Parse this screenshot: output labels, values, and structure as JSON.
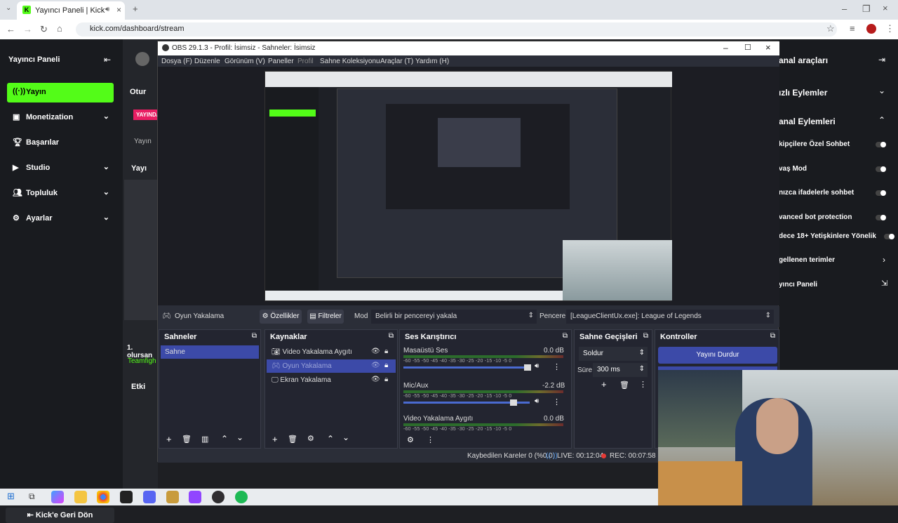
{
  "browser": {
    "tab_title": "Yayıncı Paneli | Kick",
    "url": "kick.com/dashboard/stream"
  },
  "kick": {
    "sidebar_title": "Yayıncı Paneli",
    "items": [
      {
        "label": "Yayın",
        "icon": "broadcast-icon",
        "active": true,
        "chevron": false
      },
      {
        "label": "Monetization",
        "icon": "money-icon",
        "active": false,
        "chevron": true
      },
      {
        "label": "Başarılar",
        "icon": "trophy-icon",
        "active": false,
        "chevron": false
      },
      {
        "label": "Studio",
        "icon": "studio-icon",
        "active": false,
        "chevron": true
      },
      {
        "label": "Topluluk",
        "icon": "community-icon",
        "active": false,
        "chevron": true
      },
      {
        "label": "Ayarlar",
        "icon": "gear-icon",
        "active": false,
        "chevron": true
      }
    ],
    "back_button": "Kick'e Geri Dön",
    "mid_texts": [
      "Otur",
      "YAYINDA",
      "Yayın",
      "Yayı",
      "1. olursan",
      "Teamfigh",
      "Etki"
    ],
    "right_title": "anal araçları",
    "right_items": [
      {
        "label": "ızlı Eylemler",
        "type": "chevron-down"
      },
      {
        "label": "anal Eylemleri",
        "type": "chevron-up"
      },
      {
        "label": "kipçilere Özel Sohbet",
        "type": "toggle"
      },
      {
        "label": "vaş Mod",
        "type": "toggle"
      },
      {
        "label": "nızca ifadelerle sohbet",
        "type": "toggle"
      },
      {
        "label": "vanced bot protection",
        "type": "toggle"
      },
      {
        "label": "dece 18+ Yetişkinlere Yönelik",
        "type": "toggle"
      },
      {
        "label": "gellenen terimler",
        "type": "chevron-right"
      },
      {
        "label": "yıncı Paneli",
        "type": "arrow"
      }
    ]
  },
  "obs": {
    "title": "OBS 29.1.3 - Profil: İsimsiz - Sahneler: İsimsiz",
    "menu": [
      "Dosya (F)",
      "Düzenle",
      "Görünüm (V)",
      "Paneller",
      "Profil",
      "Sahne Koleksiyonu",
      "Araçlar (T)",
      "Yardım (H)"
    ],
    "source_bar": {
      "source_name": "Oyun Yakalama",
      "properties": "Özellikler",
      "filters": "Filtreler",
      "mode_label": "Mod",
      "mode_value": "Belirli bir pencereyi yakala",
      "window_label": "Pencere",
      "window_value": "[LeagueClientUx.exe]: League of Legends"
    },
    "scenes": {
      "title": "Sahneler",
      "items": [
        "Sahne"
      ]
    },
    "sources": {
      "title": "Kaynaklar",
      "items": [
        {
          "label": "Video Yakalama Aygıtı",
          "icon": "camera-icon",
          "selected": false
        },
        {
          "label": "Oyun Yakalama",
          "icon": "gamepad-icon",
          "selected": true
        },
        {
          "label": "Ekran Yakalama",
          "icon": "monitor-icon",
          "selected": false
        }
      ]
    },
    "mixer": {
      "title": "Ses Karıştırıcı",
      "ticks": "-60 -55 -50 -45 -40 -35 -30 -25 -20 -15 -10 -5 0",
      "channels": [
        {
          "name": "Masaüstü Ses",
          "db": "0.0 dB",
          "level": 1.0
        },
        {
          "name": "Mic/Aux",
          "db": "-2.2 dB",
          "level": 0.9
        },
        {
          "name": "Video Yakalama Aygıtı",
          "db": "0.0 dB",
          "level": 1.0
        }
      ]
    },
    "transitions": {
      "title": "Sahne Geçişleri",
      "type": "Soldur",
      "duration_label": "Süre",
      "duration_value": "300 ms"
    },
    "controls": {
      "title": "Kontroller",
      "stop_stream": "Yayını Durdur"
    },
    "status": {
      "dropped": "Kaybedilen Kareler 0 (%0.0)",
      "live": "LIVE: 00:12:04",
      "rec": "REC: 00:07:58"
    }
  },
  "colors": {
    "kick_green": "#53fc18",
    "obs_blue": "#3c4aa8",
    "obs_bg": "#2b2e38"
  }
}
